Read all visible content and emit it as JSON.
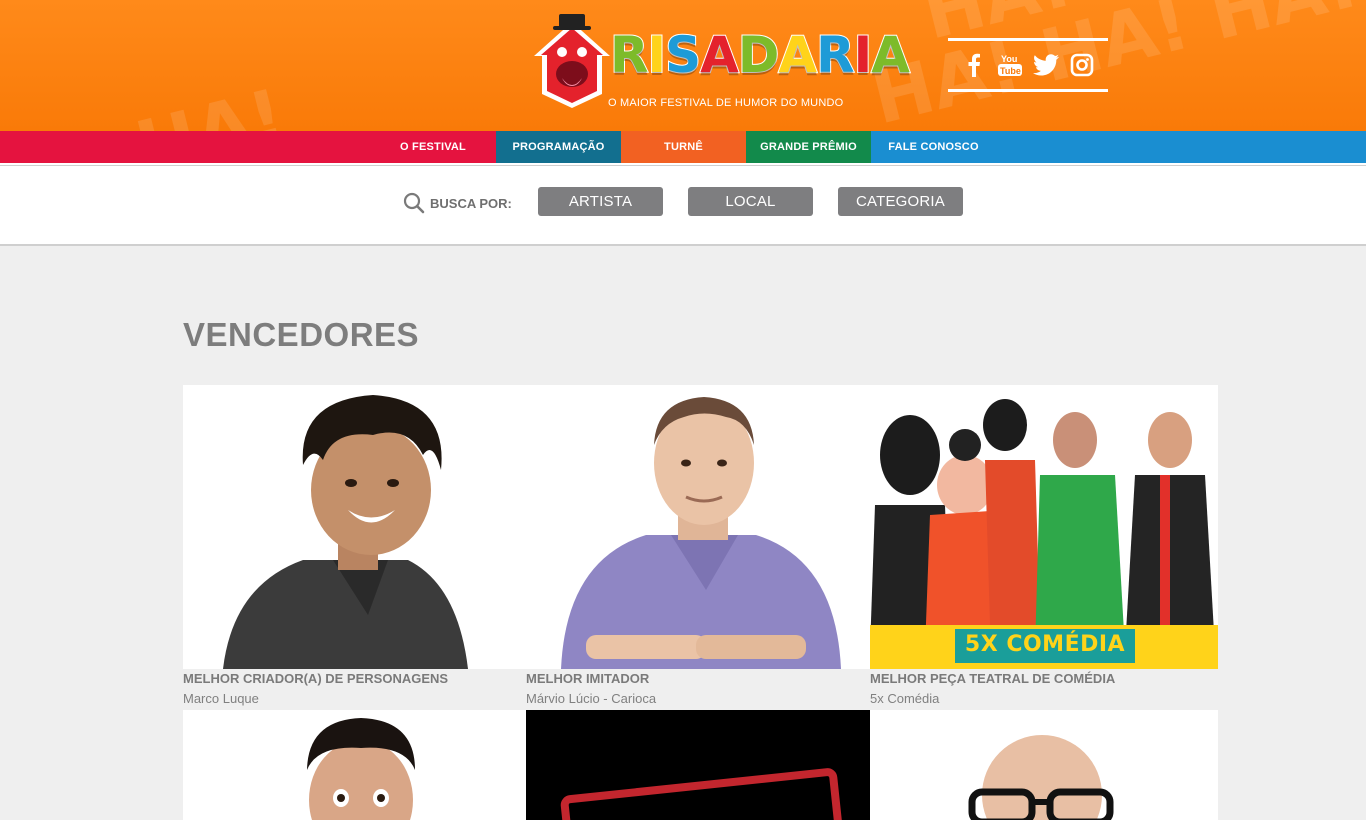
{
  "header": {
    "logo_text": "RISADARIA",
    "tagline": "O MAIOR FESTIVAL DE HUMOR DO MUNDO",
    "background_word": "HA!",
    "social": [
      {
        "name": "facebook-icon",
        "glyph": "f"
      },
      {
        "name": "youtube-icon",
        "glyph": "YouTube"
      },
      {
        "name": "twitter-icon",
        "glyph": "twitter"
      },
      {
        "name": "instagram-icon",
        "glyph": "instagram"
      }
    ]
  },
  "nav": {
    "items": [
      {
        "label": "O FESTIVAL",
        "color": "#e5133f"
      },
      {
        "label": "PROGRAMAÇÃO",
        "color": "#126f8f"
      },
      {
        "label": "TURNÊ",
        "color": "#f26122"
      },
      {
        "label": "GRANDE PRÊMIO",
        "color": "#128a4b"
      },
      {
        "label": "FALE CONOSCO",
        "color": "#1a8ed1"
      }
    ]
  },
  "search": {
    "label": "BUSCA POR:",
    "buttons": [
      "ARTISTA",
      "LOCAL",
      "CATEGORIA"
    ]
  },
  "main": {
    "title": "VENCEDORES",
    "winners": [
      {
        "category": "MELHOR CRIADOR(A) DE PERSONAGENS",
        "name": "Marco Luque"
      },
      {
        "category": "MELHOR IMITADOR",
        "name": "Márvio Lúcio - Carioca"
      },
      {
        "category": "MELHOR PEÇA TEATRAL DE COMÉDIA",
        "name": "5x Comédia",
        "poster_text": "5X COMÉDIA"
      }
    ]
  },
  "colors": {
    "header_orange": "#f97a08",
    "button_gray": "#7e7e80",
    "page_bg": "#efefef"
  }
}
